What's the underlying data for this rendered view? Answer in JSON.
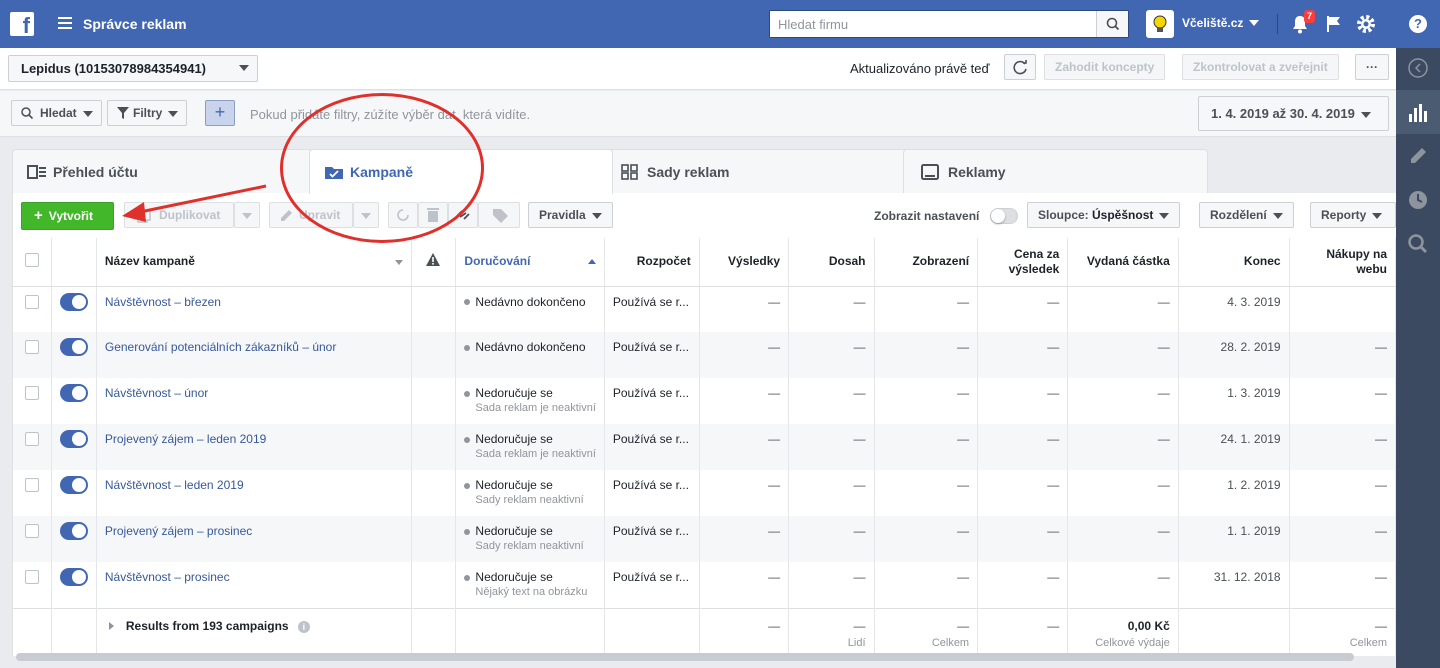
{
  "topbar": {
    "logo": "f",
    "title": "Správce reklam",
    "search_placeholder": "Hledat firmu",
    "business_name": "Včeliště.cz",
    "notification_count": "7",
    "help_label": "?"
  },
  "account_bar": {
    "account": "Lepidus (10153078984354941)",
    "updated": "Aktualizováno právě teď",
    "discard": "Zahodit koncepty",
    "review": "Zkontrolovat a zveřejnit",
    "more": "···"
  },
  "filter_bar": {
    "search": "Hledat",
    "filters": "Filtry",
    "add": "+",
    "hint": "Pokud přidáte filtry, zúžíte výběr dat, která vidíte.",
    "date_range": "1. 4. 2019 až 30. 4. 2019"
  },
  "tabs": [
    {
      "label": "Přehled účtu"
    },
    {
      "label": "Kampaně"
    },
    {
      "label": "Sady reklam"
    },
    {
      "label": "Reklamy"
    }
  ],
  "toolbar": {
    "create": "Vytvořit",
    "duplicate": "Duplikovat",
    "edit": "Upravit",
    "rules": "Pravidla",
    "show_settings": "Zobrazit nastavení",
    "columns_prefix": "Sloupce: ",
    "columns_value": "Úspěšnost",
    "breakdown": "Rozdělení",
    "reports": "Reporty"
  },
  "table": {
    "headers": {
      "name": "Název kampaně",
      "delivery": "Doručování",
      "budget": "Rozpočet",
      "results": "Výsledky",
      "reach": "Dosah",
      "impressions": "Zobrazení",
      "cost_per_result": "Cena za výsledek",
      "amount_spent": "Vydaná částka",
      "end": "Konec",
      "purchases": "Nákupy na webu"
    },
    "rows": [
      {
        "name": "Návštěvnost – březen",
        "delivery": "Nedávno dokončeno",
        "delivery_sub": "",
        "budget": "Používá se r...",
        "results": "—",
        "reach": "—",
        "impressions": "—",
        "cpr": "—",
        "spent": "—",
        "end": "4. 3. 2019",
        "purchases": ""
      },
      {
        "name": "Generování potenciálních zákazníků – únor",
        "delivery": "Nedávno dokončeno",
        "delivery_sub": "",
        "budget": "Používá se r...",
        "results": "—",
        "reach": "—",
        "impressions": "—",
        "cpr": "—",
        "spent": "—",
        "end": "28. 2. 2019",
        "purchases": "—"
      },
      {
        "name": "Návštěvnost – únor",
        "delivery": "Nedoručuje se",
        "delivery_sub": "Sada reklam je neaktivní",
        "budget": "Používá se r...",
        "results": "—",
        "reach": "—",
        "impressions": "—",
        "cpr": "—",
        "spent": "—",
        "end": "1. 3. 2019",
        "purchases": "—"
      },
      {
        "name": "Projevený zájem – leden 2019",
        "delivery": "Nedoručuje se",
        "delivery_sub": "Sada reklam je neaktivní",
        "budget": "Používá se r...",
        "results": "—",
        "reach": "—",
        "impressions": "—",
        "cpr": "—",
        "spent": "—",
        "end": "24. 1. 2019",
        "purchases": "—"
      },
      {
        "name": "Návštěvnost – leden 2019",
        "delivery": "Nedoručuje se",
        "delivery_sub": "Sady reklam neaktivní",
        "budget": "Používá se r...",
        "results": "—",
        "reach": "—",
        "impressions": "—",
        "cpr": "—",
        "spent": "—",
        "end": "1. 2. 2019",
        "purchases": "—"
      },
      {
        "name": "Projevený zájem – prosinec",
        "delivery": "Nedoručuje se",
        "delivery_sub": "Sady reklam neaktivní",
        "budget": "Používá se r...",
        "results": "—",
        "reach": "—",
        "impressions": "—",
        "cpr": "—",
        "spent": "—",
        "end": "1. 1. 2019",
        "purchases": "—"
      },
      {
        "name": "Návštěvnost – prosinec",
        "delivery": "Nedoručuje se",
        "delivery_sub": "Nějaký text na obrázku",
        "budget": "Používá se r...",
        "results": "—",
        "reach": "—",
        "impressions": "—",
        "cpr": "—",
        "spent": "—",
        "end": "31. 12. 2018",
        "purchases": "—"
      }
    ],
    "footer": {
      "label": "Results from 193 campaigns",
      "results": "—",
      "reach": "—",
      "reach_sub": "Lidí",
      "impressions": "—",
      "impressions_sub": "Celkem",
      "cpr": "—",
      "spent": "0,00 Kč",
      "spent_sub": "Celkové výdaje",
      "purchases": "—",
      "purchases_sub": "Celkem"
    }
  },
  "colors": {
    "brand": "#4267b2",
    "create_green": "#42b72a",
    "annotation_red": "#e0302c"
  },
  "icons": [
    "facebook-logo-icon",
    "menu-icon",
    "search-icon",
    "bulb-icon",
    "bell-icon",
    "flag-icon",
    "gear-icon",
    "help-icon",
    "refresh-icon",
    "filter-icon",
    "calendar-icon",
    "folder-icon",
    "grid-icon",
    "ad-icon",
    "copy-icon",
    "pencil-icon",
    "cycle-icon",
    "trash-icon",
    "link-icon",
    "tag-icon",
    "warning-icon",
    "info-icon",
    "chart-icon",
    "clock-icon",
    "zoom-icon",
    "collapse-icon"
  ]
}
